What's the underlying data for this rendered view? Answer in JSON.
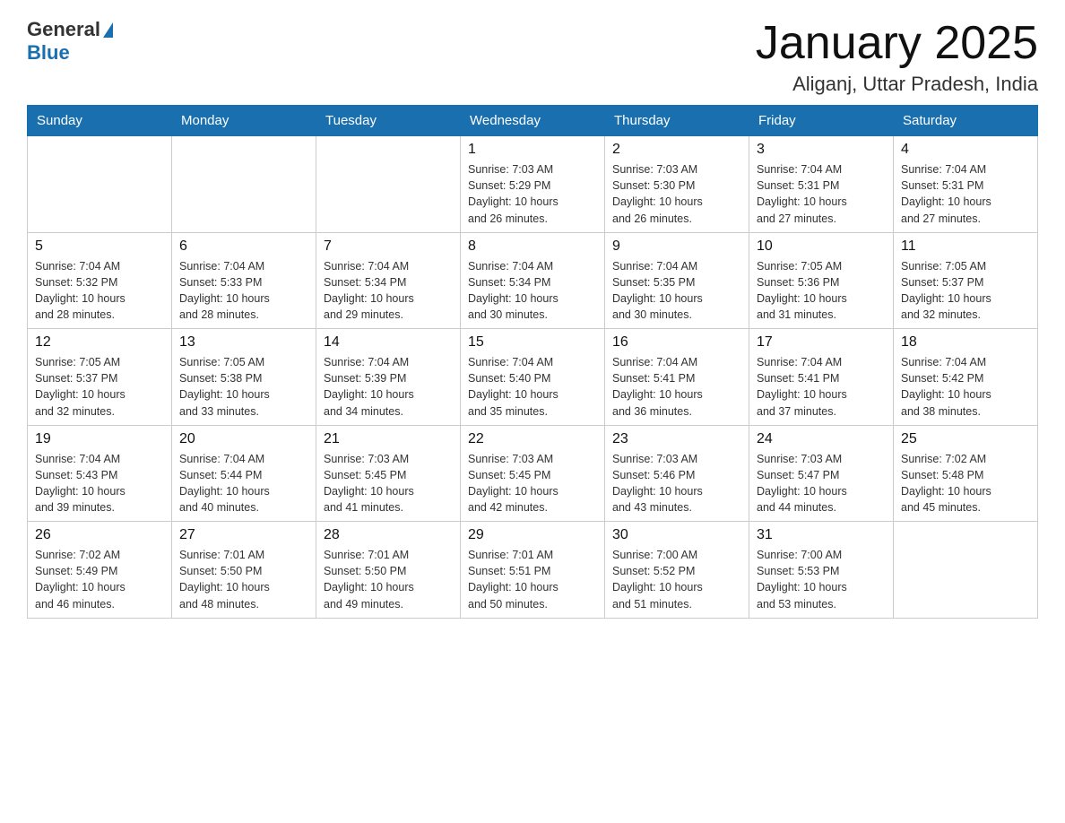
{
  "header": {
    "logo_general": "General",
    "logo_blue": "Blue",
    "month": "January 2025",
    "location": "Aliganj, Uttar Pradesh, India"
  },
  "days_of_week": [
    "Sunday",
    "Monday",
    "Tuesday",
    "Wednesday",
    "Thursday",
    "Friday",
    "Saturday"
  ],
  "weeks": [
    [
      {
        "day": "",
        "info": ""
      },
      {
        "day": "",
        "info": ""
      },
      {
        "day": "",
        "info": ""
      },
      {
        "day": "1",
        "info": "Sunrise: 7:03 AM\nSunset: 5:29 PM\nDaylight: 10 hours\nand 26 minutes."
      },
      {
        "day": "2",
        "info": "Sunrise: 7:03 AM\nSunset: 5:30 PM\nDaylight: 10 hours\nand 26 minutes."
      },
      {
        "day": "3",
        "info": "Sunrise: 7:04 AM\nSunset: 5:31 PM\nDaylight: 10 hours\nand 27 minutes."
      },
      {
        "day": "4",
        "info": "Sunrise: 7:04 AM\nSunset: 5:31 PM\nDaylight: 10 hours\nand 27 minutes."
      }
    ],
    [
      {
        "day": "5",
        "info": "Sunrise: 7:04 AM\nSunset: 5:32 PM\nDaylight: 10 hours\nand 28 minutes."
      },
      {
        "day": "6",
        "info": "Sunrise: 7:04 AM\nSunset: 5:33 PM\nDaylight: 10 hours\nand 28 minutes."
      },
      {
        "day": "7",
        "info": "Sunrise: 7:04 AM\nSunset: 5:34 PM\nDaylight: 10 hours\nand 29 minutes."
      },
      {
        "day": "8",
        "info": "Sunrise: 7:04 AM\nSunset: 5:34 PM\nDaylight: 10 hours\nand 30 minutes."
      },
      {
        "day": "9",
        "info": "Sunrise: 7:04 AM\nSunset: 5:35 PM\nDaylight: 10 hours\nand 30 minutes."
      },
      {
        "day": "10",
        "info": "Sunrise: 7:05 AM\nSunset: 5:36 PM\nDaylight: 10 hours\nand 31 minutes."
      },
      {
        "day": "11",
        "info": "Sunrise: 7:05 AM\nSunset: 5:37 PM\nDaylight: 10 hours\nand 32 minutes."
      }
    ],
    [
      {
        "day": "12",
        "info": "Sunrise: 7:05 AM\nSunset: 5:37 PM\nDaylight: 10 hours\nand 32 minutes."
      },
      {
        "day": "13",
        "info": "Sunrise: 7:05 AM\nSunset: 5:38 PM\nDaylight: 10 hours\nand 33 minutes."
      },
      {
        "day": "14",
        "info": "Sunrise: 7:04 AM\nSunset: 5:39 PM\nDaylight: 10 hours\nand 34 minutes."
      },
      {
        "day": "15",
        "info": "Sunrise: 7:04 AM\nSunset: 5:40 PM\nDaylight: 10 hours\nand 35 minutes."
      },
      {
        "day": "16",
        "info": "Sunrise: 7:04 AM\nSunset: 5:41 PM\nDaylight: 10 hours\nand 36 minutes."
      },
      {
        "day": "17",
        "info": "Sunrise: 7:04 AM\nSunset: 5:41 PM\nDaylight: 10 hours\nand 37 minutes."
      },
      {
        "day": "18",
        "info": "Sunrise: 7:04 AM\nSunset: 5:42 PM\nDaylight: 10 hours\nand 38 minutes."
      }
    ],
    [
      {
        "day": "19",
        "info": "Sunrise: 7:04 AM\nSunset: 5:43 PM\nDaylight: 10 hours\nand 39 minutes."
      },
      {
        "day": "20",
        "info": "Sunrise: 7:04 AM\nSunset: 5:44 PM\nDaylight: 10 hours\nand 40 minutes."
      },
      {
        "day": "21",
        "info": "Sunrise: 7:03 AM\nSunset: 5:45 PM\nDaylight: 10 hours\nand 41 minutes."
      },
      {
        "day": "22",
        "info": "Sunrise: 7:03 AM\nSunset: 5:45 PM\nDaylight: 10 hours\nand 42 minutes."
      },
      {
        "day": "23",
        "info": "Sunrise: 7:03 AM\nSunset: 5:46 PM\nDaylight: 10 hours\nand 43 minutes."
      },
      {
        "day": "24",
        "info": "Sunrise: 7:03 AM\nSunset: 5:47 PM\nDaylight: 10 hours\nand 44 minutes."
      },
      {
        "day": "25",
        "info": "Sunrise: 7:02 AM\nSunset: 5:48 PM\nDaylight: 10 hours\nand 45 minutes."
      }
    ],
    [
      {
        "day": "26",
        "info": "Sunrise: 7:02 AM\nSunset: 5:49 PM\nDaylight: 10 hours\nand 46 minutes."
      },
      {
        "day": "27",
        "info": "Sunrise: 7:01 AM\nSunset: 5:50 PM\nDaylight: 10 hours\nand 48 minutes."
      },
      {
        "day": "28",
        "info": "Sunrise: 7:01 AM\nSunset: 5:50 PM\nDaylight: 10 hours\nand 49 minutes."
      },
      {
        "day": "29",
        "info": "Sunrise: 7:01 AM\nSunset: 5:51 PM\nDaylight: 10 hours\nand 50 minutes."
      },
      {
        "day": "30",
        "info": "Sunrise: 7:00 AM\nSunset: 5:52 PM\nDaylight: 10 hours\nand 51 minutes."
      },
      {
        "day": "31",
        "info": "Sunrise: 7:00 AM\nSunset: 5:53 PM\nDaylight: 10 hours\nand 53 minutes."
      },
      {
        "day": "",
        "info": ""
      }
    ]
  ]
}
